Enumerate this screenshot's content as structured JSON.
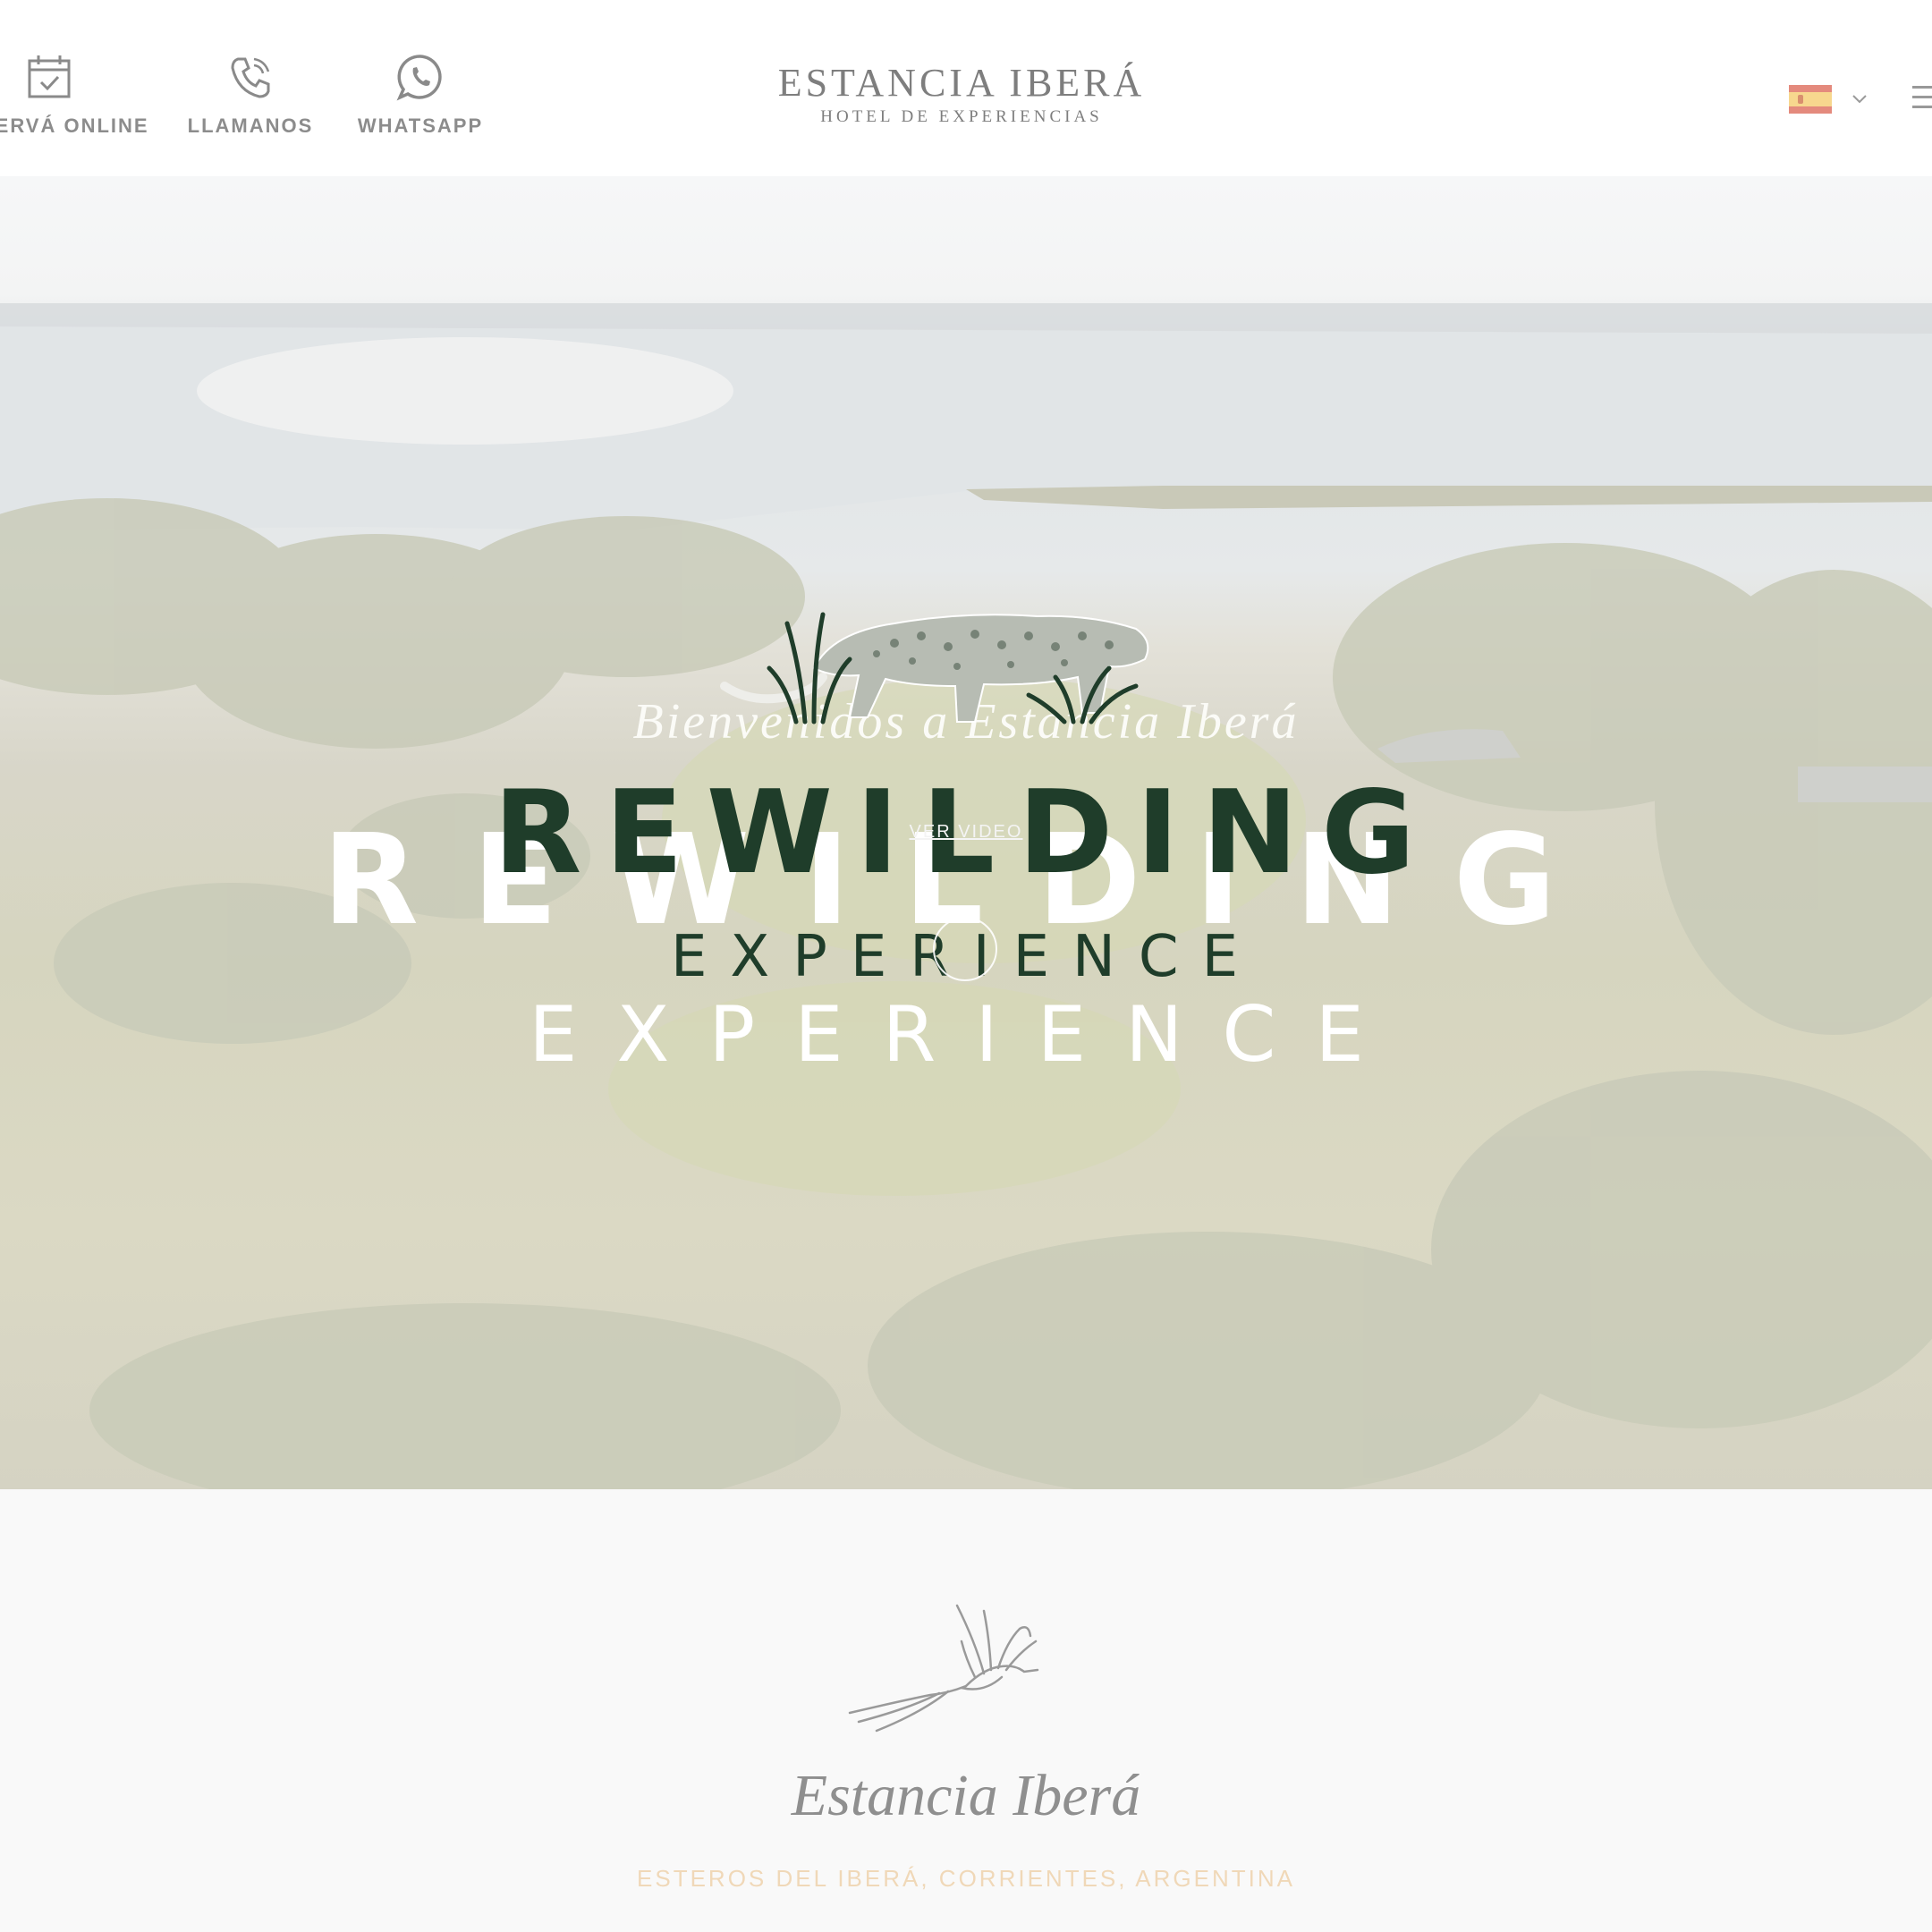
{
  "header": {
    "actions": [
      {
        "label": "RESERVÁ ONLINE",
        "icon": "calendar-check-icon"
      },
      {
        "label": "LLAMANOS",
        "icon": "phone-icon"
      },
      {
        "label": "WHATSAPP",
        "icon": "whatsapp-icon"
      }
    ],
    "brand": {
      "name": "ESTANCIA IBERÁ",
      "tagline": "HOTEL DE EXPERIENCIAS"
    },
    "language": {
      "selected": "es",
      "flag": "spain-flag-icon"
    },
    "menu_icon": "hamburger-menu-icon"
  },
  "hero": {
    "welcome": "Bienvenidos a Estancia Iberá",
    "logo_line1": "REWILDING",
    "logo_line2": "EXPERIENCE",
    "video_link": "VER VIDEO",
    "play_icon": "play-icon"
  },
  "intro": {
    "logo_icon": "bird-icon",
    "title": "Estancia Iberá",
    "location": "ESTEROS DEL IBERÁ, CORRIENTES, ARGENTINA"
  },
  "colors": {
    "logo_green": "#1f3d2a",
    "accent_sand": "#f0d8b8",
    "header_text": "#8c8c8c"
  }
}
